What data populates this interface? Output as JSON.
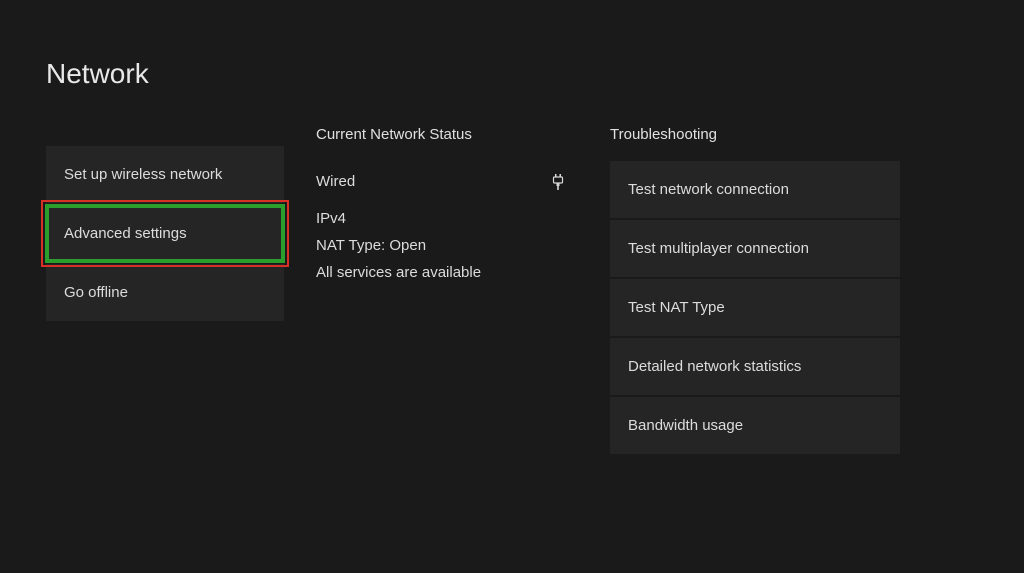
{
  "page": {
    "title": "Network"
  },
  "left": {
    "setup_wireless": "Set up wireless network",
    "advanced_settings": "Advanced settings",
    "go_offline": "Go offline"
  },
  "status": {
    "header": "Current Network Status",
    "connection_type": "Wired",
    "ip_version": "IPv4",
    "nat_type": "NAT Type: Open",
    "services": "All services are available"
  },
  "troubleshooting": {
    "header": "Troubleshooting",
    "test_network": "Test network connection",
    "test_multiplayer": "Test multiplayer connection",
    "test_nat": "Test NAT Type",
    "detailed_stats": "Detailed network statistics",
    "bandwidth": "Bandwidth usage"
  }
}
